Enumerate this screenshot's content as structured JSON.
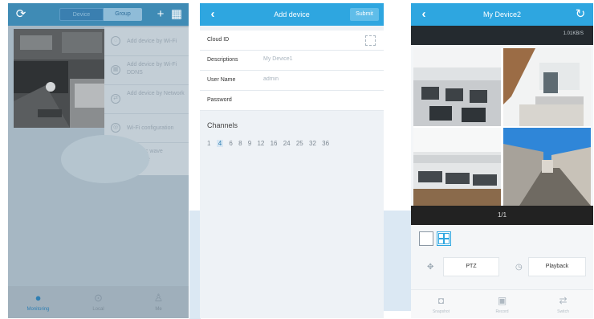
{
  "screen1": {
    "top_icons": {
      "left": "refresh-icon",
      "right": [
        "plus-icon",
        "qr-icon"
      ]
    },
    "segments": [
      "Device",
      "Group"
    ],
    "menu": [
      {
        "icon": "wifi-icon",
        "label": "Add device by Wi-Fi"
      },
      {
        "icon": "qr-icon",
        "label": "Add device by Wi-Fi DDNS"
      },
      {
        "icon": "lan-icon",
        "label": "Add device by Network"
      },
      {
        "icon": "wifi-config-icon",
        "label": "Wi-Fi configuration"
      },
      {
        "icon": "sound-icon",
        "label": "Acoustic wave configure"
      }
    ],
    "tabs": [
      {
        "icon": "camera-icon",
        "label": "Monitoring"
      },
      {
        "icon": "media-icon",
        "label": "Local"
      },
      {
        "icon": "user-icon",
        "label": "Me"
      }
    ],
    "colors": {
      "topbar": "#3f8bb5",
      "overlay": "#a6b7c3"
    }
  },
  "screen2": {
    "back_icon": "chevron-left-icon",
    "title": "Add device",
    "submit": "Submit",
    "fields": [
      {
        "label": "Cloud ID",
        "value": ""
      },
      {
        "label": "Descriptions",
        "value": "My Device1"
      },
      {
        "label": "User Name",
        "value": "admin"
      },
      {
        "label": "Password",
        "value": ""
      }
    ],
    "scan_icon": "scan-icon",
    "channels_heading": "Channels",
    "channels": [
      "1",
      "4",
      "6",
      "8",
      "9",
      "12",
      "16",
      "24",
      "25",
      "32",
      "36"
    ],
    "selected_channel": "4",
    "colors": {
      "topbar": "#2ea6e0",
      "accent": "#2ea6e0"
    }
  },
  "screen3": {
    "back_icon": "chevron-left-icon",
    "title": "My Device2",
    "rotate_icon": "rotate-icon",
    "wifi_status": "1.01KB/S",
    "page": "1/1",
    "layout_icons": [
      "single-view-icon",
      "quad-view-icon"
    ],
    "controls": [
      {
        "icon": "ptz-icon",
        "label": "PTZ"
      },
      {
        "icon": "clock-icon",
        "label": "Playback"
      }
    ],
    "tabs": [
      {
        "icon": "snapshot-icon",
        "label": "Snapshot"
      },
      {
        "icon": "record-icon",
        "label": "Record"
      },
      {
        "icon": "switch-icon",
        "label": "Switch"
      }
    ],
    "colors": {
      "topbar": "#2ea6e0"
    }
  }
}
